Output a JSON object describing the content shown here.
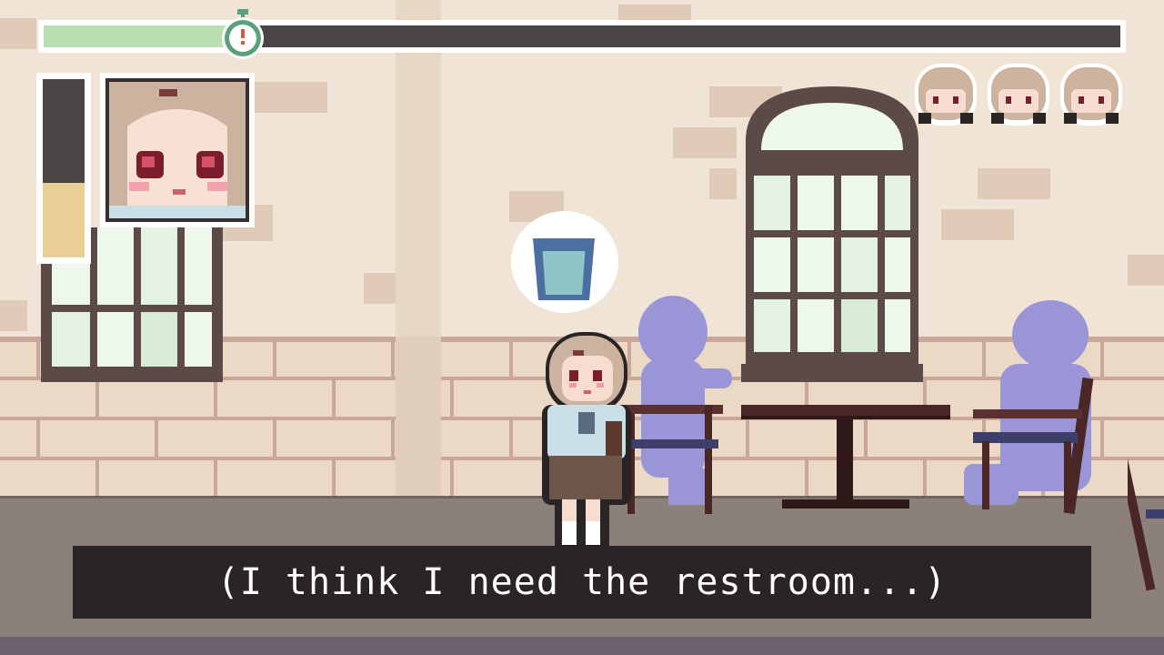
{
  "hud": {
    "timer_fraction": 0.18,
    "bladder_level_fraction": 0.42,
    "lives_remaining": 3,
    "timer_icon": "stopwatch-icon",
    "thought_icon": "cup-icon"
  },
  "dialog": {
    "text": "(I think I need the restroom...)"
  },
  "colors": {
    "timer_fill": "#b8e0b0",
    "bladder_fill": "#e8cf95",
    "dialog_bg": "#2a2524",
    "silhouette": "#9a95d6"
  }
}
